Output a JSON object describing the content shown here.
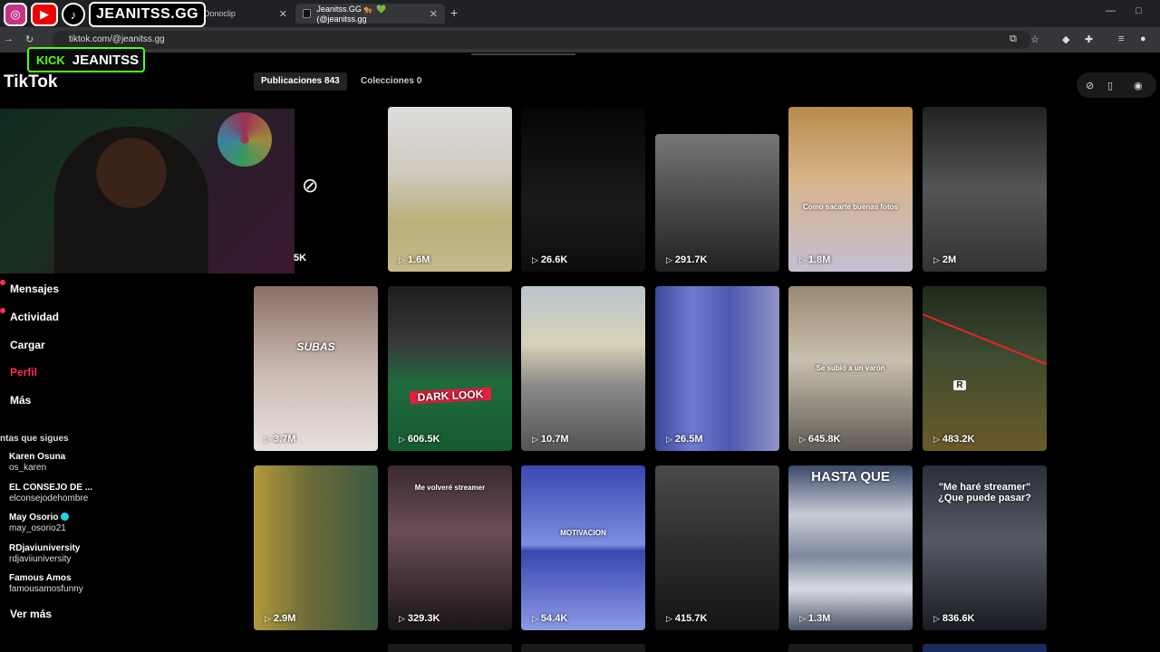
{
  "browser": {
    "tabs": [
      {
        "title": "nbox | Donoclip",
        "close": "✕"
      },
      {
        "title": "Jeanitss.GG 🐅 💚 (@jeanitss.gg",
        "close": "✕"
      }
    ],
    "new_tab": "+",
    "url": "tiktok.com/@jeanitss.gg"
  },
  "overlay": {
    "social_handle": "JEANITSS.GG",
    "kick_logo": "KICK",
    "kick_name": "JEANITSS"
  },
  "sidebar": {
    "brand": "TikTok",
    "items": [
      {
        "label": "Mensajes",
        "active": false,
        "badge": true
      },
      {
        "label": "Actividad",
        "active": false,
        "badge": true
      },
      {
        "label": "Cargar",
        "active": false,
        "badge": false
      },
      {
        "label": "Perfil",
        "active": true,
        "badge": false
      },
      {
        "label": "Más",
        "active": false,
        "badge": false
      }
    ],
    "following_title": "ntas que sigues",
    "accounts": [
      {
        "name": "Karen Osuna",
        "handle": "os_karen",
        "verified": false
      },
      {
        "name": "EL CONSEJO DE ...",
        "handle": "elconsejodehombre",
        "verified": false
      },
      {
        "name": "May Osorio",
        "handle": "may_osorio21",
        "verified": true
      },
      {
        "name": "RDjaviuniversity",
        "handle": "rdjaviiuniversity",
        "verified": false
      },
      {
        "name": "Famous Amos",
        "handle": "famousamosfunny",
        "verified": false
      }
    ],
    "see_more": "Ver más"
  },
  "profile": {
    "tabs": [
      {
        "label": "Publicaciones 843",
        "active": true
      },
      {
        "label": "Colecciones 0",
        "active": false
      }
    ],
    "partial_views": "5K"
  },
  "videos": [
    {
      "views": "1.6M",
      "caption": ""
    },
    {
      "views": "26.6K",
      "caption": ""
    },
    {
      "views": "291.7K",
      "caption": ""
    },
    {
      "views": "1.8M",
      "caption": "Como sacarte buenas fotos"
    },
    {
      "views": "2M",
      "caption": ""
    },
    {
      "views": "3.7M",
      "caption": "SUBAS"
    },
    {
      "views": "606.5K",
      "caption": "DARK LOOK"
    },
    {
      "views": "10.7M",
      "caption": ""
    },
    {
      "views": "26.5M",
      "caption": ""
    },
    {
      "views": "645.8K",
      "caption": "Se subió a un varón"
    },
    {
      "views": "483.2K",
      "caption": "R"
    },
    {
      "views": "2.9M",
      "caption": ""
    },
    {
      "views": "329.3K",
      "caption": "Me volveré streamer"
    },
    {
      "views": "54.4K",
      "caption": "MOTIVACION"
    },
    {
      "views": "415.7K",
      "caption": ""
    },
    {
      "views": "1.3M",
      "caption": "HASTA QUE"
    },
    {
      "views": "836.6K",
      "caption": "\"Me haré streamer\" ¿Que puede pasar?"
    }
  ],
  "colors": {
    "accent": "#fe2c55",
    "kick": "#53fc18"
  }
}
